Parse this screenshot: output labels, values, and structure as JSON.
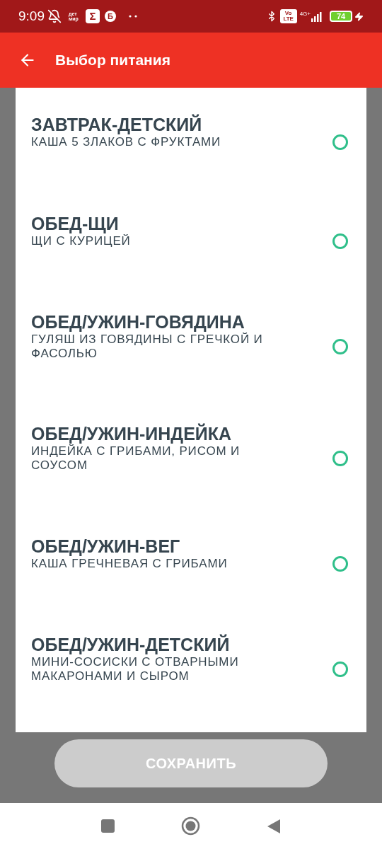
{
  "status_bar": {
    "time": "9:09",
    "notifications": [
      "дет мир",
      "Σ",
      "Б"
    ],
    "network": "4G+",
    "volte": "Vo LTE",
    "battery": "74"
  },
  "app_bar": {
    "title": "Выбор питания"
  },
  "meals": [
    {
      "title": "ЗАВТРАК-ДЕТСКИЙ",
      "description": "КАША 5 ЗЛАКОВ С ФРУКТАМИ",
      "selected": false
    },
    {
      "title": "ОБЕД-ЩИ",
      "description": "ЩИ С КУРИЦЕЙ",
      "selected": false
    },
    {
      "title": "ОБЕД/УЖИН-ГОВЯДИНА",
      "description": "ГУЛЯШ ИЗ ГОВЯДИНЫ С ГРЕЧКОЙ И ФАСОЛЬЮ",
      "selected": false
    },
    {
      "title": "ОБЕД/УЖИН-ИНДЕЙКА",
      "description": "ИНДЕЙКА С ГРИБАМИ, РИСОМ И СОУСОМ",
      "selected": false
    },
    {
      "title": "ОБЕД/УЖИН-ВЕГ",
      "description": "КАША ГРЕЧНЕВАЯ С ГРИБАМИ",
      "selected": false
    },
    {
      "title": "ОБЕД/УЖИН-ДЕТСКИЙ",
      "description": "МИНИ-СОСИСКИ С ОТВАРНЫМИ МАКАРОНАМИ И СЫРОМ",
      "selected": false
    }
  ],
  "save_button": {
    "label": "СОХРАНИТЬ",
    "disabled": true
  }
}
